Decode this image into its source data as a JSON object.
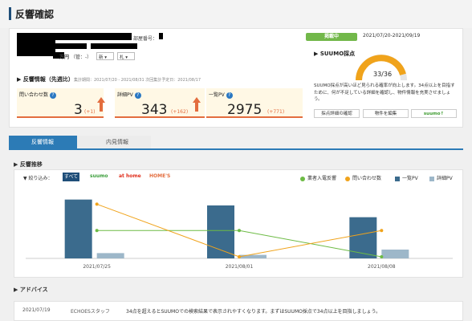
{
  "page": {
    "title": "反響確認"
  },
  "property": {
    "room_label": "部屋番号：",
    "price_unit": "万円",
    "layout_paren": "（管：-）",
    "select_a": "新",
    "select_b": "札"
  },
  "response_info": {
    "heading": "反響情報（先週比）",
    "meta": "集計期間：2021/07/20 - 2021/08/31  次回集計予定日：2021/08/17",
    "kpis": [
      {
        "label": "問い合わせ数",
        "value": "3",
        "delta": "(+1)"
      },
      {
        "label": "詳細PV",
        "value": "343",
        "delta": "(+162)"
      },
      {
        "label": "一覧PV",
        "value": "2975",
        "delta": "(+771)"
      }
    ]
  },
  "status": {
    "badge": "掲載中",
    "period": "2021/07/20-2021/09/19"
  },
  "suumo_score": {
    "heading": "SUUMO採点",
    "score": 33,
    "max": 36,
    "score_text": "33/36",
    "description": "SUUMO採点が高いほど見られる確率が向上します。34点以上を目指すために、何が不足している詳細を確認し、物件情報を充実させましょう。",
    "buttons": [
      "採点詳細の確認",
      "物件を編集",
      "suumo↑"
    ]
  },
  "tabs": [
    {
      "label": "反響情報",
      "active": true
    },
    {
      "label": "内見情報",
      "active": false
    }
  ],
  "trend": {
    "heading": "反響推移",
    "filter_label": "絞り込み：",
    "filters": [
      "すべて",
      "suumo",
      "at home",
      "HOME'S"
    ],
    "legend": [
      {
        "label": "業者入電反響",
        "color": "#6dbb45",
        "shape": "dot"
      },
      {
        "label": "問い合わせ数",
        "color": "#f0a31b",
        "shape": "dot"
      },
      {
        "label": "一覧PV",
        "color": "#3b6b8d",
        "shape": "square"
      },
      {
        "label": "詳細PV",
        "color": "#9db7c9",
        "shape": "square"
      }
    ]
  },
  "chart_data": {
    "type": "bar",
    "categories": [
      "2021/07/25",
      "2021/08/01",
      "2021/08/08"
    ],
    "series": [
      {
        "name": "一覧PV",
        "kind": "bar",
        "color": "#3b6b8d",
        "values": [
          1000,
          900,
          700
        ]
      },
      {
        "name": "詳細PV",
        "kind": "bar",
        "color": "#9db7c9",
        "values": [
          90,
          60,
          150
        ]
      },
      {
        "name": "業者入電反響",
        "kind": "line",
        "color": "#6dbb45",
        "values": [
          2,
          2,
          0
        ]
      },
      {
        "name": "問い合わせ数",
        "kind": "line",
        "color": "#f0a31b",
        "values": [
          4,
          0,
          2
        ]
      }
    ],
    "bar_ylim": [
      0,
      1200
    ],
    "line_ylim": [
      0,
      5
    ]
  },
  "advice": {
    "heading": "アドバイス",
    "rows": [
      {
        "date": "2021/07/19",
        "author": "ECHOESスタッフ",
        "text": "34点を超えるとSUUMOでの検索結果で表示されやすくなります。まずはSUUMO採点で34点以上を目指しましょう。"
      }
    ]
  }
}
